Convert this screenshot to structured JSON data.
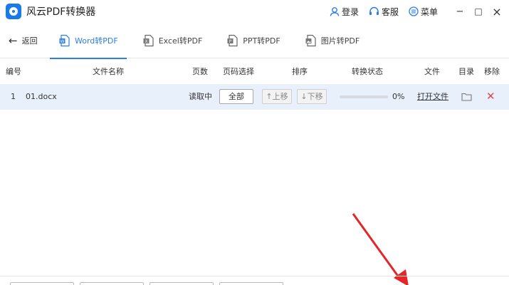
{
  "app": {
    "title": "风云PDF转换器",
    "login": "登录",
    "support": "客服",
    "menu": "菜单",
    "minimize": "−",
    "maximize": "□",
    "close": "×",
    "accent_color": "#2b7de9",
    "logo_color": "#1a7be8"
  },
  "toolbar": {
    "back_label": "返回",
    "tabs": [
      {
        "label": "Word转PDF",
        "icon": "word-file-icon",
        "active": true
      },
      {
        "label": "Excel转PDF",
        "icon": "excel-file-icon",
        "active": false
      },
      {
        "label": "PPT转PDF",
        "icon": "ppt-file-icon",
        "active": false
      },
      {
        "label": "图片转PDF",
        "icon": "image-file-icon",
        "active": false
      }
    ]
  },
  "table": {
    "headers": {
      "index": "编号",
      "filename": "文件名称",
      "pages": "页数",
      "page_select": "页码选择",
      "order": "排序",
      "status": "转换状态",
      "file": "文件",
      "dir": "目录",
      "remove": "移除"
    },
    "rows": [
      {
        "index": "1",
        "filename": "01.docx",
        "pages": "读取中",
        "page_select": "全部",
        "move_up": "↑上移",
        "move_down": "↓下移",
        "progress_percent": 0,
        "progress_text": "0%",
        "open_file": "打开文件"
      }
    ]
  }
}
